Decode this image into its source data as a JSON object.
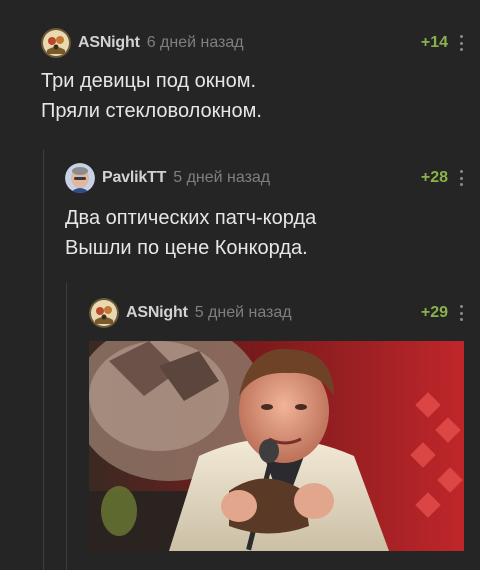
{
  "comments": [
    {
      "author": "ASNight",
      "time": "6 дней назад",
      "rating": "+14",
      "text": "Три девицы под окном.\nПряли стекловолокном."
    },
    {
      "author": "PavlikTT",
      "time": "5 дней назад",
      "rating": "+28",
      "text": "Два оптических патч-корда\nВышли по цене Конкорда."
    },
    {
      "author": "ASNight",
      "time": "5 дней назад",
      "rating": "+29",
      "text": ""
    }
  ],
  "colors": {
    "background": "#252526",
    "rating": "#8ab24b",
    "author": "#d2d2d2",
    "time": "#7f7f7f",
    "text": "#e6e6e6"
  },
  "icons": {
    "avatar": "user-avatar-icon",
    "more": "more-vertical-icon"
  }
}
